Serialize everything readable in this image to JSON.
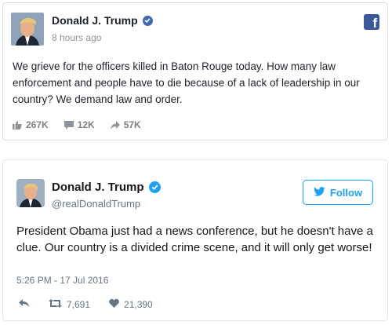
{
  "facebook_post": {
    "author": "Donald J. Trump",
    "time": "8 hours ago",
    "text": "We grieve for the officers killed in Baton Rouge today. How many law enforcement and people have to die because of a lack of leadership in our country? We demand law and order.",
    "likes": "267K",
    "comments": "12K",
    "shares": "57K",
    "logo_letter": "f",
    "colors": {
      "brand": "#3b5998",
      "verified": "#4267b2",
      "stats": "#7f7f7f"
    }
  },
  "tweet": {
    "author": "Donald J. Trump",
    "handle": "@realDonaldTrump",
    "follow_label": "Follow",
    "text": "President Obama just had a news conference, but he doesn't have a clue. Our country is a divided crime scene, and it will only get worse!",
    "timestamp": "5:26 PM - 17 Jul 2016",
    "retweets": "7,691",
    "likes": "21,390",
    "colors": {
      "brand": "#1da1f2",
      "muted": "#657786"
    }
  },
  "icons": [
    "verified-badge-icon",
    "facebook-logo-icon",
    "thumbs-up-icon",
    "comment-icon",
    "share-arrow-icon",
    "twitter-bird-icon",
    "reply-icon",
    "retweet-icon",
    "heart-icon"
  ]
}
